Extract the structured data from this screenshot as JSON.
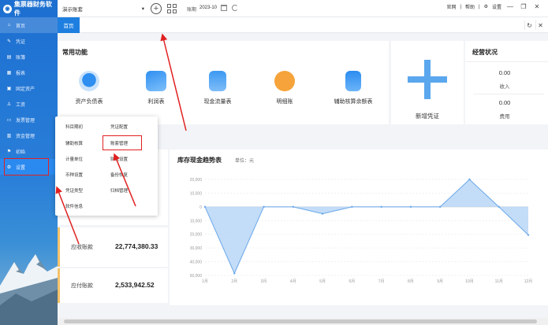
{
  "app": {
    "logo_text": "集票器财务软件"
  },
  "sidebar": {
    "items": [
      {
        "label": "首页"
      },
      {
        "label": "凭证"
      },
      {
        "label": "账簿"
      },
      {
        "label": "报表"
      },
      {
        "label": "固定资产"
      },
      {
        "label": "工资"
      },
      {
        "label": "发票管理"
      },
      {
        "label": "资金管理"
      },
      {
        "label": "初始"
      },
      {
        "label": "设置"
      }
    ]
  },
  "topbar": {
    "account": "演示账套",
    "period_label": "账期",
    "period_value": "2023-10",
    "links": [
      "官网",
      "帮助",
      "设置"
    ]
  },
  "tabs": {
    "home": "首页"
  },
  "common": {
    "title": "常用功能",
    "items": [
      "资产负债表",
      "利润表",
      "现金流量表",
      "明细账",
      "辅助核算余额表"
    ],
    "new_voucher": "新增凭证"
  },
  "business": {
    "title": "经营状况",
    "income_value": "0.00",
    "income_label": "收入",
    "expense_value": "0.00",
    "expense_label": "费用"
  },
  "popup": {
    "left": [
      "科目期初",
      "辅助核算",
      "计量单位",
      "币种设置",
      "凭证类型",
      "软件信息"
    ],
    "right": [
      "凭证配置",
      "账套管理",
      "财税设置",
      "备份恢复",
      "归档管理"
    ]
  },
  "stats": [
    {
      "label": "应收账款",
      "value": "22,774,380.33"
    },
    {
      "label": "应付账款",
      "value": "2,533,942.52"
    }
  ],
  "chart_data": {
    "type": "area",
    "title": "库存现金趋势表",
    "unit_label": "单位：元",
    "categories": [
      "1月",
      "2月",
      "3月",
      "4月",
      "5月",
      "6月",
      "7月",
      "8月",
      "9月",
      "10月",
      "11月",
      "12月"
    ],
    "values": [
      0,
      -48500,
      0,
      0,
      -5000,
      0,
      0,
      0,
      0,
      20000,
      0,
      -20500
    ],
    "ylim": [
      -50000,
      20000
    ],
    "yticks": [
      20000,
      10000,
      0,
      -10000,
      -20000,
      -30000,
      -40000,
      -50000
    ],
    "ytick_labels": [
      "20,000",
      "10,000",
      "0",
      "10,000",
      "20,000",
      "30,000",
      "40,000",
      "50,000"
    ],
    "grid": true,
    "colors": {
      "line": "#6aa7ea",
      "fill": "#b9d6f6"
    }
  }
}
